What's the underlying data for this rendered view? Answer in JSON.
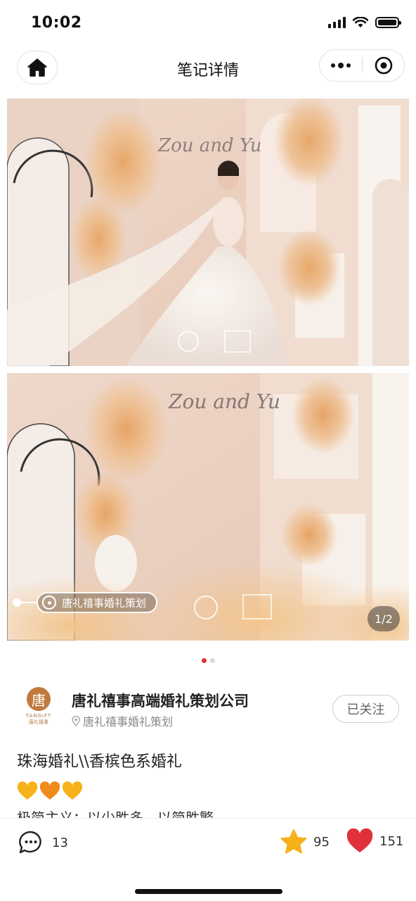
{
  "status_bar": {
    "time": "10:02"
  },
  "nav": {
    "title": "笔记详情"
  },
  "photos": {
    "location_tag": "唐礼禧事婚礼策划",
    "page_indicator": "1/2",
    "count": 2,
    "active_index": 0
  },
  "author": {
    "name": "唐礼禧事高端婚礼策划公司",
    "location": "唐礼禧事婚礼策划",
    "follow_label": "已关注",
    "logo_char": "唐",
    "logo_brand": "TANGIFT",
    "logo_brand_cn": "唐礼禧事"
  },
  "note": {
    "title": "珠海婚礼\\\\香槟色系婚礼",
    "emojis": [
      "💛",
      "🧡",
      "💛"
    ],
    "body_preview": "极简主义：以少胜多，以简胜繁"
  },
  "actions": {
    "comments": "13",
    "stars": "95",
    "likes": "151"
  },
  "colors": {
    "accent_red": "#e0313b",
    "star_yellow": "#f6b21a"
  }
}
